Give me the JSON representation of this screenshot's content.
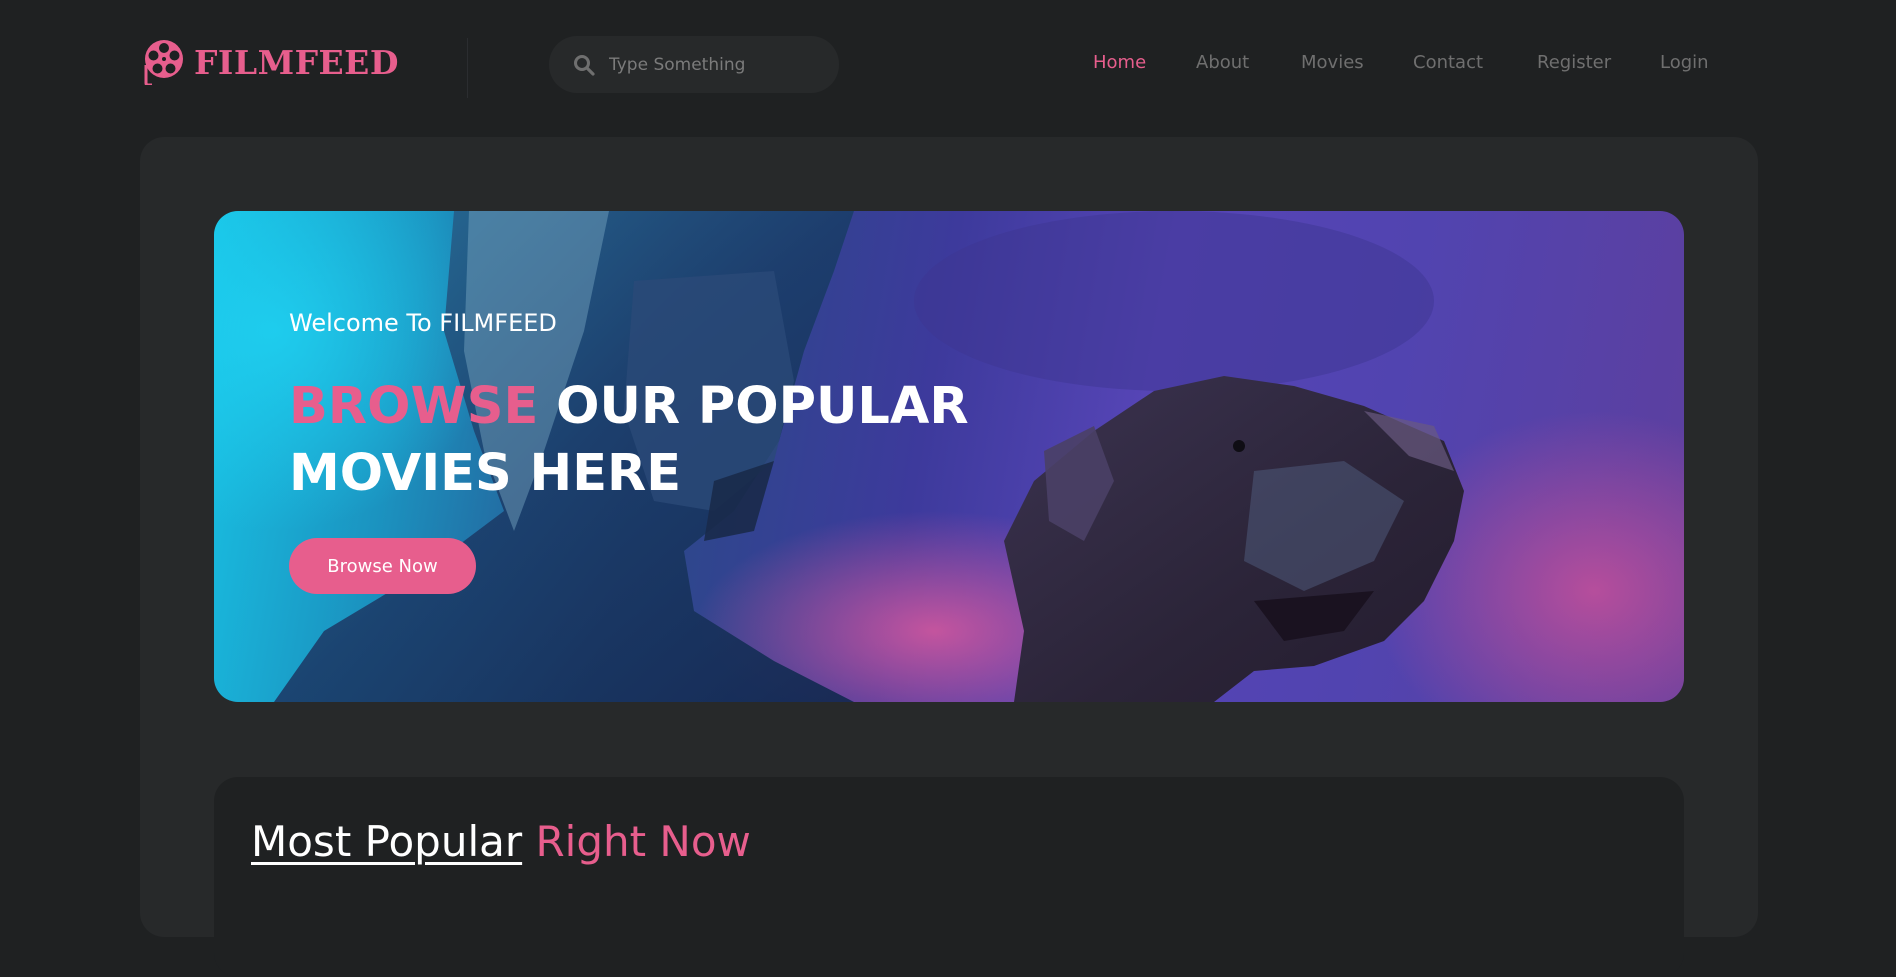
{
  "header": {
    "logo_text": "FILMFEED",
    "logo_icon": "film-reel-icon",
    "search": {
      "placeholder": "Type Something",
      "value": "",
      "icon": "search-icon"
    },
    "nav": [
      {
        "label": "Home",
        "active": true
      },
      {
        "label": "About",
        "active": false
      },
      {
        "label": "Movies",
        "active": false
      },
      {
        "label": "Contact",
        "active": false
      },
      {
        "label": "Register",
        "active": false
      },
      {
        "label": "Login",
        "active": false
      }
    ]
  },
  "banner": {
    "subtitle": "Welcome To FILMFEED",
    "heading_accent": "BROWSE",
    "heading_rest": " OUR POPULAR MOVIES HERE",
    "button_label": "Browse Now"
  },
  "popular": {
    "title_main": "Most Popular",
    "title_accent": " Right Now"
  },
  "colors": {
    "background": "#1f2122",
    "card": "#27292a",
    "accent": "#e75e8d",
    "nav_text": "#6f6f6f",
    "text": "#ffffff"
  }
}
